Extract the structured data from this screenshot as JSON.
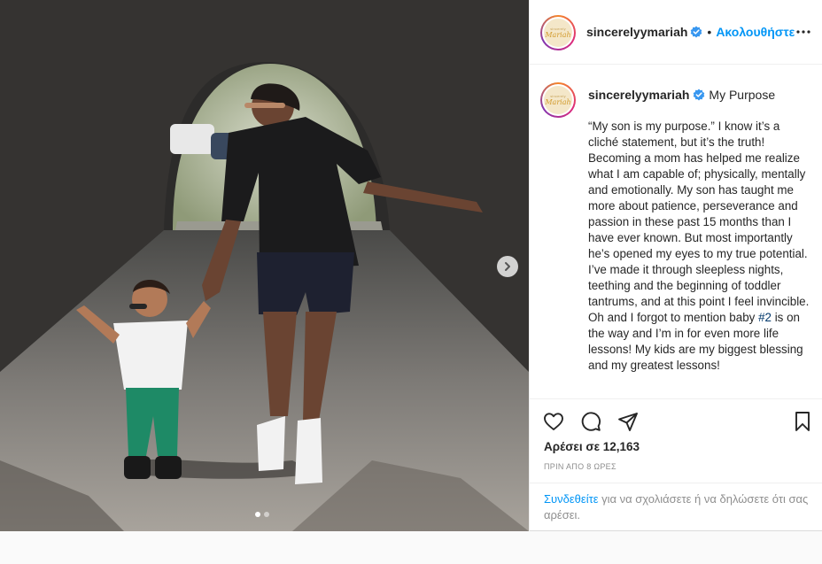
{
  "header": {
    "avatar_top": "sincerely",
    "avatar_bottom": "Mariah",
    "username": "sincerelyymariah",
    "separator": "•",
    "follow_label": "Ακολουθήστε"
  },
  "caption": {
    "username": "sincerelyymariah",
    "title": "My Purpose",
    "text_before": "“My son is my purpose.” I know it’s a cliché statement, but it’s the truth! Becoming a mom has helped me realize what I am capable of; physically, mentally and emotionally. My son has taught me more about patience, perseverance and passion in these past 15 months than I have ever known. But most importantly he’s opened my eyes to my true potential. I’ve made it through sleepless nights, teething and the beginning of toddler tantrums, and at this point I feel invincible. Oh and I forgot to mention baby ",
    "hashtag": "#2",
    "text_after": " is on the way and I’m in for even more life lessons! My kids are my biggest blessing and my greatest lessons!"
  },
  "likes": "Αρέσει σε 12,163",
  "time_ago": "ΠΡΙΝ ΑΠΟ 8 ΩΡΕΣ",
  "login": {
    "link": "Συνδεθείτε",
    "rest": " για να σχολιάσετε ή να δηλώσετε ότι σας αρέσει."
  },
  "carousel": {
    "current": 1,
    "total": 2
  },
  "colors": {
    "accent": "#0095f6",
    "verified": "#3897f0",
    "text": "#262626",
    "muted": "#8e8e8e"
  },
  "icons": [
    "more-icon",
    "heart-icon",
    "comment-icon",
    "share-icon",
    "bookmark-icon",
    "chevron-right-icon",
    "verified-icon"
  ]
}
